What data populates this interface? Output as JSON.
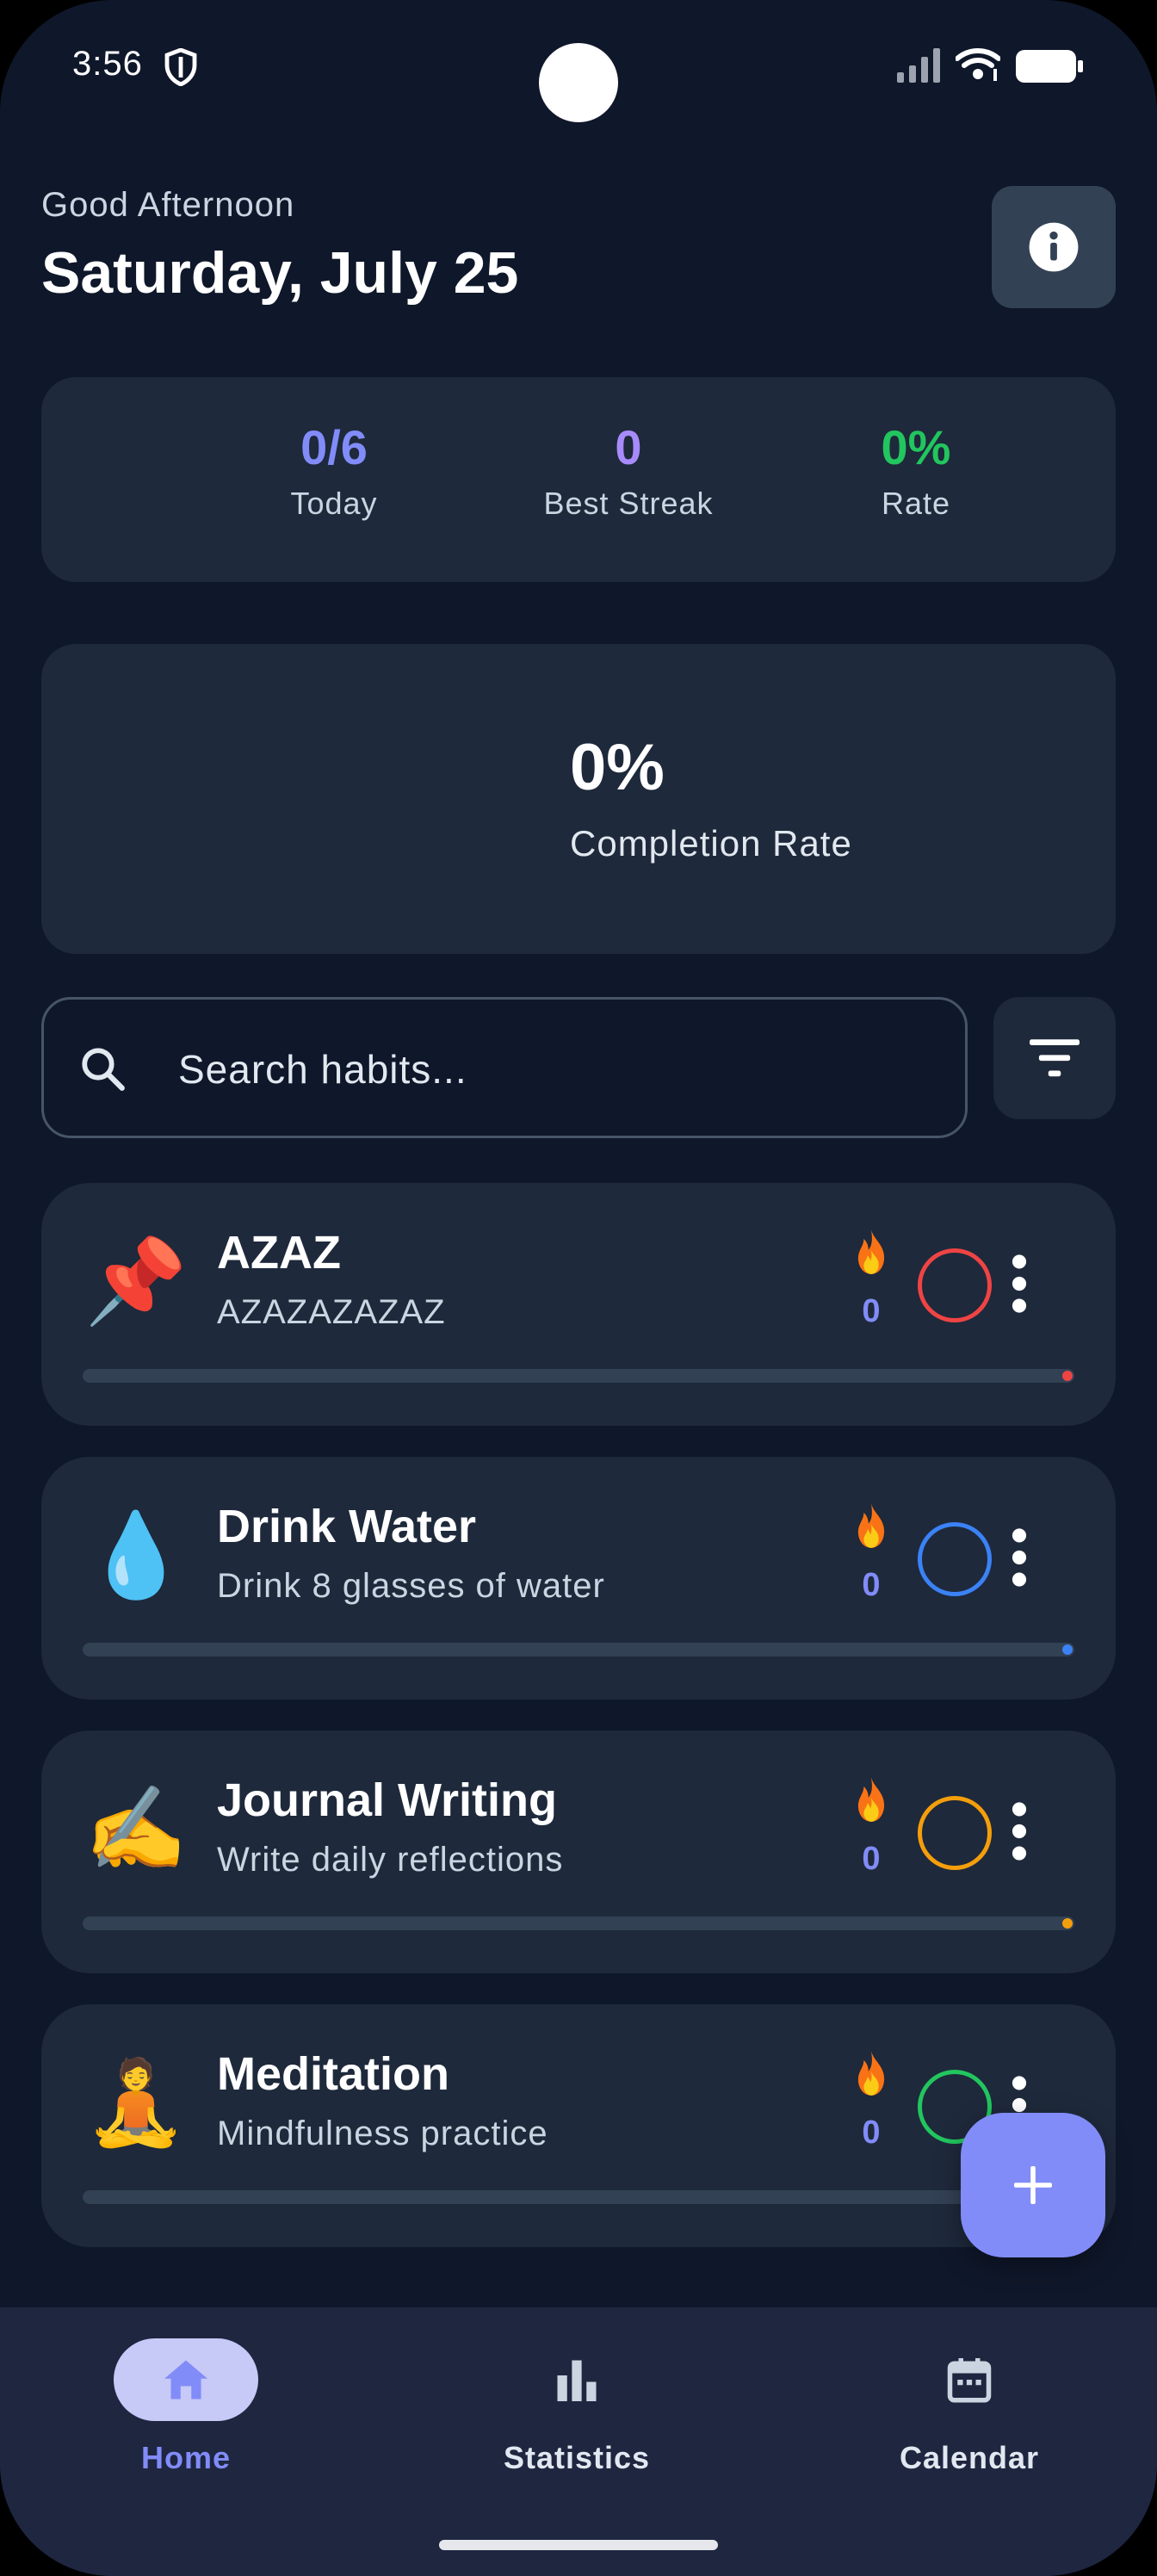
{
  "status_bar": {
    "time": "3:56",
    "icons": [
      "shield-icon",
      "signal-icon",
      "wifi-icon",
      "battery-icon"
    ]
  },
  "header": {
    "greeting": "Good Afternoon",
    "date": "Saturday, July 25",
    "info_icon": "info-icon"
  },
  "stats": [
    {
      "value": "0/6",
      "label": "Today",
      "color": "#818cf8"
    },
    {
      "value": "0",
      "label": "Best Streak",
      "color": "#a78bfa"
    },
    {
      "value": "0%",
      "label": "Rate",
      "color": "#22c55e"
    }
  ],
  "completion": {
    "value": "0%",
    "label": "Completion Rate"
  },
  "search": {
    "placeholder": "Search habits...",
    "value": "",
    "icon": "search-icon",
    "filter_icon": "filter-icon"
  },
  "habits": [
    {
      "emoji": "📌",
      "name": "AZAZ",
      "description": "AZAZAZAZAZ",
      "streak": "0",
      "color": "#ef4444",
      "progress": 0
    },
    {
      "emoji": "💧",
      "name": "Drink Water",
      "description": "Drink 8 glasses of water",
      "streak": "0",
      "color": "#3b82f6",
      "progress": 0
    },
    {
      "emoji": "✍️",
      "name": "Journal Writing",
      "description": "Write daily reflections",
      "streak": "0",
      "color": "#f59e0b",
      "progress": 0
    },
    {
      "emoji": "🧘",
      "name": "Meditation",
      "description": "Mindfulness practice",
      "streak": "0",
      "color": "#22c55e",
      "progress": 0
    }
  ],
  "fab": {
    "icon": "plus-icon"
  },
  "nav": {
    "active": "Home",
    "items": [
      {
        "label": "Home",
        "icon": "home-icon"
      },
      {
        "label": "Statistics",
        "icon": "bar-chart-icon"
      },
      {
        "label": "Calendar",
        "icon": "calendar-icon"
      }
    ]
  },
  "colors": {
    "background": "#0f172a",
    "card": "#1e293b",
    "accent": "#818cf8"
  }
}
